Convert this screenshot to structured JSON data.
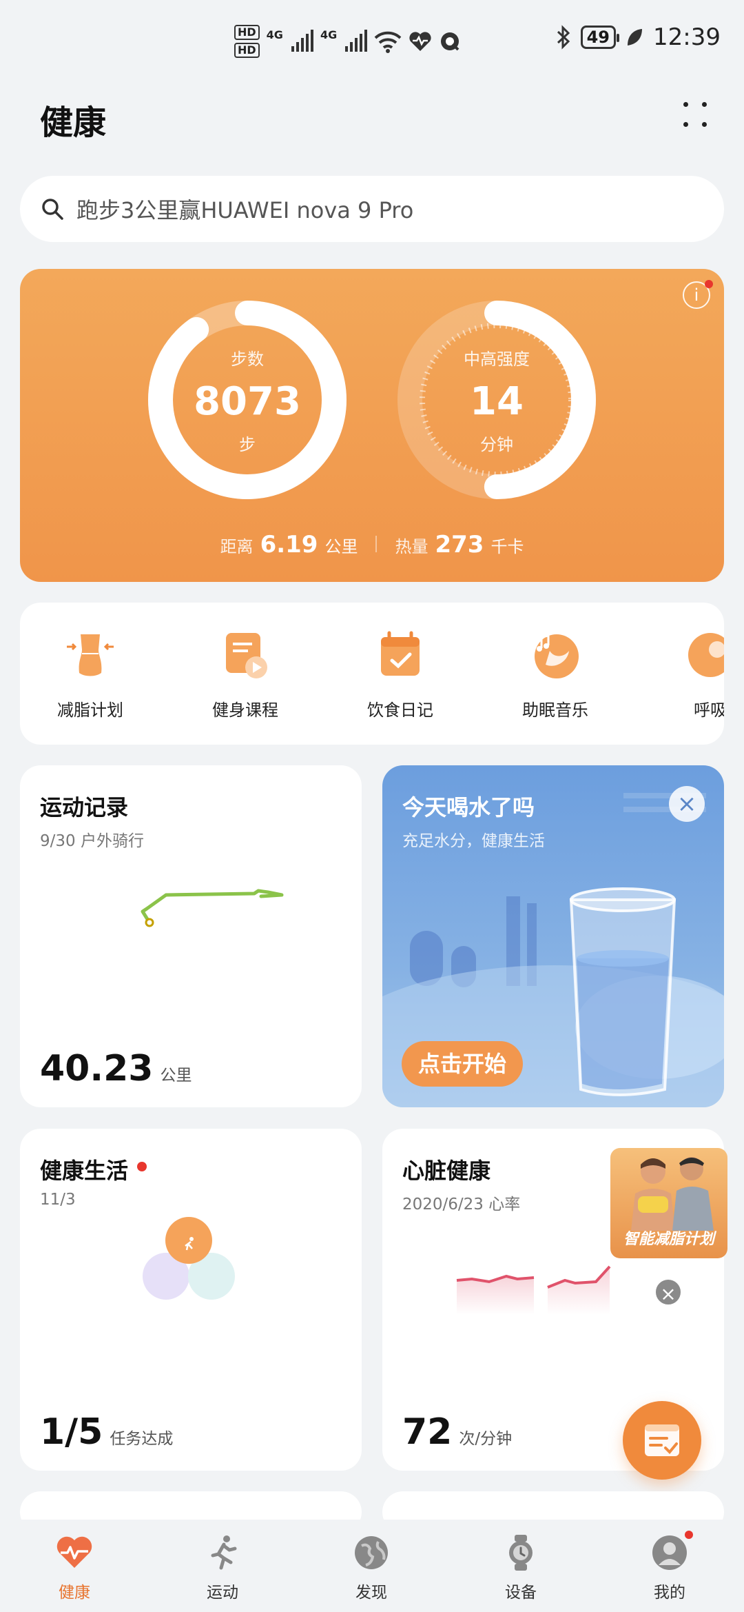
{
  "status_bar": {
    "sim1": "HD",
    "sim2": "HD",
    "net1": "4G",
    "net2": "4G",
    "battery": "49",
    "time": "12:39"
  },
  "header": {
    "title": "健康"
  },
  "search": {
    "placeholder": "跑步3公里赢HUAWEI nova 9 Pro"
  },
  "activity": {
    "steps": {
      "label": "步数",
      "value": "8073",
      "unit": "步",
      "progress": 0.9
    },
    "intensity": {
      "label": "中高强度",
      "value": "14",
      "unit": "分钟",
      "progress": 0.5
    },
    "distance": {
      "label": "距离",
      "value": "6.19",
      "unit": "公里"
    },
    "calories": {
      "label": "热量",
      "value": "273",
      "unit": "千卡"
    }
  },
  "shortcuts": [
    {
      "label": "减脂计划",
      "icon": "fat-loss-plan-icon"
    },
    {
      "label": "健身课程",
      "icon": "fitness-course-icon"
    },
    {
      "label": "饮食日记",
      "icon": "diet-diary-icon"
    },
    {
      "label": "助眠音乐",
      "icon": "sleep-music-icon"
    },
    {
      "label": "呼吸",
      "icon": "breathing-icon"
    }
  ],
  "cards": {
    "exercise": {
      "title": "运动记录",
      "subtitle": "9/30  户外骑行",
      "value": "40.23",
      "unit": "公里"
    },
    "water": {
      "title": "今天喝水了吗",
      "subtitle": "充足水分，健康生活",
      "button": "点击开始"
    },
    "healthy_living": {
      "title": "健康生活",
      "subtitle": "11/3",
      "value": "1/5",
      "unit": "任务达成"
    },
    "heart": {
      "title": "心脏健康",
      "subtitle": "2020/6/23  心率",
      "value": "72",
      "unit": "次/分钟"
    }
  },
  "promo": {
    "text": "智能减脂计划"
  },
  "bottom_nav": [
    {
      "label": "健康",
      "icon": "heart-pulse-icon",
      "active": true
    },
    {
      "label": "运动",
      "icon": "runner-icon",
      "active": false
    },
    {
      "label": "发现",
      "icon": "globe-icon",
      "active": false
    },
    {
      "label": "设备",
      "icon": "watch-icon",
      "active": false
    },
    {
      "label": "我的",
      "icon": "profile-icon",
      "active": false
    }
  ],
  "colors": {
    "accent": "#f08a3c",
    "hero_top": "#f3a85a",
    "hero_bottom": "#f0954a",
    "water_blue": "#6c9ede",
    "route_green": "#8bc34a",
    "heart_line": "#e0536b"
  }
}
